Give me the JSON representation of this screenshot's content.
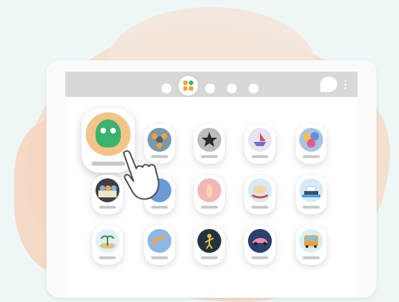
{
  "colors": {
    "background": "#eef6f8",
    "blob": "#f6dcc8",
    "topbar": "#d8d8d8",
    "tablet": "#fafafa",
    "accent_orange": "#f2a33a",
    "accent_green": "#3bb36b"
  },
  "topbar": {
    "nav_icons": [
      "dot-icon",
      "apps-grid-icon",
      "dot-icon",
      "dot-icon",
      "dot-icon"
    ],
    "active_index": 1,
    "right_icons": [
      "chat-bubble-icon",
      "more-vertical-icon"
    ]
  },
  "featured_app": {
    "icon": "green-monster-icon",
    "selected": true
  },
  "app_grid": {
    "rows": [
      [
        "green-monster-icon",
        "fidget-spinner-icon",
        "black-star-icon",
        "sailboat-icon",
        "balloons-icon"
      ],
      [
        "abc-letters-icon",
        "blue-circle-icon",
        "pink-figure-icon",
        "rocking-horse-icon",
        "ship-icon"
      ],
      [
        "palm-island-icon",
        "airplane-icon",
        "stick-figure-icon",
        "pink-car-icon",
        "bus-icon"
      ]
    ]
  },
  "pointer": {
    "icon": "tap-hand-icon"
  }
}
